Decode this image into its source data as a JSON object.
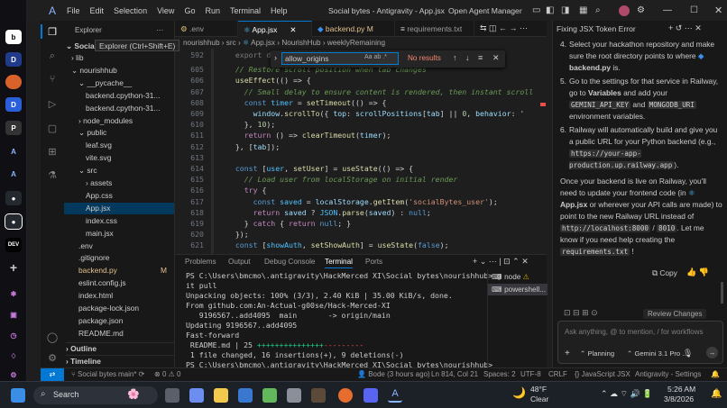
{
  "window": {
    "title": "Social bytes - Antigravity - App.jsx",
    "agent_manager": "Open Agent Manager",
    "menus": [
      "File",
      "Edit",
      "Selection",
      "View",
      "Go",
      "Run",
      "Terminal",
      "Help"
    ]
  },
  "explorer": {
    "header": "Explorer",
    "root": "Social",
    "tooltip": "Explorer (Ctrl+Shift+E)",
    "items": [
      {
        "label": "lib",
        "depth": 1,
        "kind": "folder-closed"
      },
      {
        "label": "nourishhub",
        "depth": 1,
        "kind": "folder-open"
      },
      {
        "label": "__pycache__",
        "depth": 2,
        "kind": "folder-open"
      },
      {
        "label": "backend.cpython-31...",
        "depth": 3,
        "kind": "file"
      },
      {
        "label": "backend.cpython-31...",
        "depth": 3,
        "kind": "file"
      },
      {
        "label": "node_modules",
        "depth": 2,
        "kind": "folder-closed"
      },
      {
        "label": "public",
        "depth": 2,
        "kind": "folder-open"
      },
      {
        "label": "leaf.svg",
        "depth": 3,
        "kind": "file"
      },
      {
        "label": "vite.svg",
        "depth": 3,
        "kind": "file"
      },
      {
        "label": "src",
        "depth": 2,
        "kind": "folder-open"
      },
      {
        "label": "assets",
        "depth": 3,
        "kind": "folder-closed"
      },
      {
        "label": "App.css",
        "depth": 3,
        "kind": "file"
      },
      {
        "label": "App.jsx",
        "depth": 3,
        "kind": "file",
        "selected": true
      },
      {
        "label": "index.css",
        "depth": 3,
        "kind": "file"
      },
      {
        "label": "main.jsx",
        "depth": 3,
        "kind": "file"
      },
      {
        "label": ".env",
        "depth": 2,
        "kind": "file"
      },
      {
        "label": ".gitignore",
        "depth": 2,
        "kind": "file"
      },
      {
        "label": "backend.py",
        "depth": 2,
        "kind": "file",
        "badge": "M"
      },
      {
        "label": "eslint.config.js",
        "depth": 2,
        "kind": "file"
      },
      {
        "label": "index.html",
        "depth": 2,
        "kind": "file"
      },
      {
        "label": "package-lock.json",
        "depth": 2,
        "kind": "file"
      },
      {
        "label": "package.json",
        "depth": 2,
        "kind": "file"
      },
      {
        "label": "README.md",
        "depth": 2,
        "kind": "file"
      }
    ],
    "outline": "Outline",
    "timeline": "Timeline"
  },
  "tabs": [
    {
      "label": ".env"
    },
    {
      "label": "App.jsx",
      "active": true
    },
    {
      "label": "backend.py",
      "badge": "M"
    },
    {
      "label": "requirements.txt"
    }
  ],
  "breadcrumb": [
    "nourishhub",
    "src",
    "App.jsx",
    "NourishHub",
    "weeklyRemaining"
  ],
  "find": {
    "value": "allow_origins",
    "result": "No results"
  },
  "code": {
    "lines": [
      {
        "n": "592",
        "t": [
          [
            "pn",
            "  export default "
          ]
        ]
      },
      {
        "n": "605",
        "t": [
          [
            "cm",
            "  // Restore scroll position when tab changes"
          ]
        ]
      },
      {
        "n": "606",
        "t": [
          [
            "fn",
            "  useEffect"
          ],
          [
            "pn",
            "(() => {"
          ]
        ]
      },
      {
        "n": "607",
        "t": [
          [
            "cm",
            "    // Small delay to ensure content is rendered, then instant scroll"
          ]
        ]
      },
      {
        "n": "608",
        "t": [
          [
            "kw",
            "    const "
          ],
          [
            "cs",
            "timer"
          ],
          [
            "pn",
            " = "
          ],
          [
            "fn",
            "setTimeout"
          ],
          [
            "pn",
            "(() => {"
          ]
        ]
      },
      {
        "n": "609",
        "t": [
          [
            "vr",
            "      window"
          ],
          [
            "pn",
            "."
          ],
          [
            "fn",
            "scrollTo"
          ],
          [
            "pn",
            "({ "
          ],
          [
            "vr",
            "top"
          ],
          [
            "pn",
            ": "
          ],
          [
            "vr",
            "scrollPositions"
          ],
          [
            "pn",
            "["
          ],
          [
            "vr",
            "tab"
          ],
          [
            "pn",
            "] || "
          ],
          [
            "nm",
            "0"
          ],
          [
            "pn",
            ", "
          ],
          [
            "vr",
            "behavior"
          ],
          [
            "pn",
            ": '"
          ]
        ]
      },
      {
        "n": "610",
        "t": [
          [
            "pn",
            "    }, "
          ],
          [
            "nm",
            "10"
          ],
          [
            "pn",
            ");"
          ]
        ]
      },
      {
        "n": "611",
        "t": [
          [
            "ct",
            "    return "
          ],
          [
            "pn",
            "() => "
          ],
          [
            "fn",
            "clearTimeout"
          ],
          [
            "pn",
            "("
          ],
          [
            "vr",
            "timer"
          ],
          [
            "pn",
            ");"
          ]
        ]
      },
      {
        "n": "612",
        "t": [
          [
            "pn",
            "  }, ["
          ],
          [
            "vr",
            "tab"
          ],
          [
            "pn",
            "]);"
          ]
        ]
      },
      {
        "n": "613",
        "t": [
          [
            "pn",
            ""
          ]
        ]
      },
      {
        "n": "614",
        "t": [
          [
            "kw",
            "  const "
          ],
          [
            "pn",
            "["
          ],
          [
            "cs",
            "user"
          ],
          [
            "pn",
            ", "
          ],
          [
            "fn",
            "setUser"
          ],
          [
            "pn",
            "] = "
          ],
          [
            "fn",
            "useState"
          ],
          [
            "pn",
            "(() => {"
          ]
        ]
      },
      {
        "n": "615",
        "t": [
          [
            "cm",
            "    // Load user from localStorage on initial render"
          ]
        ]
      },
      {
        "n": "616",
        "t": [
          [
            "ct",
            "    try "
          ],
          [
            "pn",
            "{"
          ]
        ]
      },
      {
        "n": "617",
        "t": [
          [
            "kw",
            "      const "
          ],
          [
            "cs",
            "saved"
          ],
          [
            "pn",
            " = "
          ],
          [
            "vr",
            "localStorage"
          ],
          [
            "pn",
            "."
          ],
          [
            "fn",
            "getItem"
          ],
          [
            "pn",
            "("
          ],
          [
            "st",
            "'socialBytes_user'"
          ],
          [
            "pn",
            ");"
          ]
        ]
      },
      {
        "n": "618",
        "t": [
          [
            "ct",
            "      return "
          ],
          [
            "vr",
            "saved"
          ],
          [
            "pn",
            " ? "
          ],
          [
            "cs",
            "JSON"
          ],
          [
            "pn",
            "."
          ],
          [
            "fn",
            "parse"
          ],
          [
            "pn",
            "("
          ],
          [
            "vr",
            "saved"
          ],
          [
            "pn",
            ") : "
          ],
          [
            "kw",
            "null"
          ],
          [
            "pn",
            ";"
          ]
        ]
      },
      {
        "n": "619",
        "t": [
          [
            "pn",
            "    } "
          ],
          [
            "ct",
            "catch "
          ],
          [
            "pn",
            "{ "
          ],
          [
            "ct",
            "return "
          ],
          [
            "kw",
            "null"
          ],
          [
            "pn",
            "; }"
          ]
        ]
      },
      {
        "n": "620",
        "t": [
          [
            "pn",
            "  });"
          ]
        ]
      },
      {
        "n": "621",
        "t": [
          [
            "kw",
            "  const "
          ],
          [
            "pn",
            "["
          ],
          [
            "cs",
            "showAuth"
          ],
          [
            "pn",
            ", "
          ],
          [
            "fn",
            "setShowAuth"
          ],
          [
            "pn",
            "] = "
          ],
          [
            "fn",
            "useState"
          ],
          [
            "pn",
            "("
          ],
          [
            "kw",
            "false"
          ],
          [
            "pn",
            ");"
          ]
        ]
      }
    ]
  },
  "panel": {
    "tabs": [
      "Problems",
      "Output",
      "Debug Console",
      "Terminal",
      "Ports"
    ],
    "active": "Terminal",
    "terminal_lines": [
      "PS C:\\Users\\bmcmo\\.antigravity\\HackMerced XI\\Social bytes\\nourishhub> g",
      "it pull",
      "Unpacking objects: 100% (3/3), 2.40 KiB | 35.00 KiB/s, done.",
      "From github.com:An-Actual-g00se/Hack-Merced-XI",
      "   9196567..add4095  main       -> origin/main",
      "Updating 9196567..add4095",
      "Fast-forward",
      " README.md | 25 +++++++++++++++---------",
      " 1 file changed, 16 insertions(+), 9 deletions(-)",
      "PS C:\\Users\\bmcmo\\.antigravity\\HackMerced XI\\Social bytes\\nourishhub> "
    ],
    "sessions": [
      "node",
      "powershell..."
    ]
  },
  "chat": {
    "title": "Fixing JSX Token Error",
    "step4": "Select your hackathon repository and make sure the root directory points to where",
    "step4_file": "backend.py",
    "step4_end": "is.",
    "step5a": "Go to the settings for that service in Railway, go to",
    "step5_bold": "Variables",
    "step5b": "and add your",
    "var1": "GEMINI_API_KEY",
    "and": "and",
    "var2": "MONGODB_URI",
    "step5c": "environment variables.",
    "step6a": "Railway will automatically build and give you a public URL for your Python backend (e.g.,",
    "url": "https://your-app-production.up.railway.app",
    "step6b": ").",
    "para1": "Once your backend is live on Railway, you'll need to update your frontend code (in",
    "para1_file": "App.jsx",
    "para1_b": "or wherever your API calls are made) to point to the new Railway URL instead of",
    "localhost": "http://localhost:8000",
    "slash": "/",
    "port": "8010",
    "para2a": "Let me know if you need help creating the",
    "req": "requirements.txt",
    "para2b": "!",
    "copy": "Copy",
    "review": "Review Changes",
    "input_placeholder": "Ask anything, @ to mention, / for workflows",
    "mode": "Planning",
    "model": "Gemini 3.1 Pro ..."
  },
  "status": {
    "branch": "Social bytes",
    "sync": "main*",
    "errors": "0",
    "warnings": "0",
    "blame": "Bode (3 hours ago)",
    "position": "Ln 814, Col 21",
    "spaces": "Spaces: 2",
    "encoding": "UTF-8",
    "eol": "CRLF",
    "language": "JavaScript JSX",
    "settings": "Antigravity - Settings"
  },
  "taskbar": {
    "search": "Search",
    "weather_temp": "48°F",
    "weather_desc": "Clear",
    "time": "5:26 AM",
    "date": "3/8/2026"
  },
  "colors": {
    "accent": "#0078d4",
    "modified": "#e2c08d",
    "statusbar": "#181818"
  }
}
